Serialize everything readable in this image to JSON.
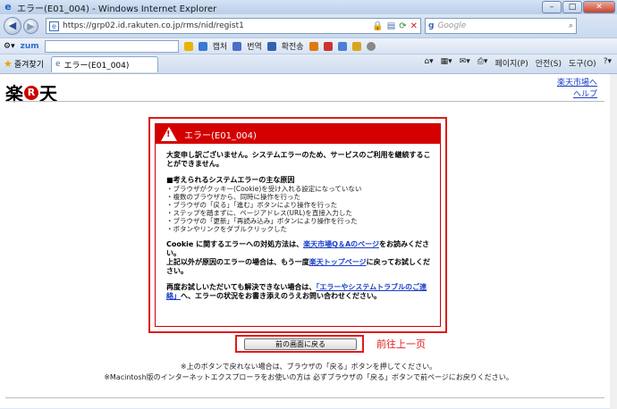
{
  "window": {
    "title": "エラー(E01_004) - Windows Internet Explorer",
    "minimize": "–",
    "maximize": "□",
    "close": "✕"
  },
  "address_bar": {
    "url": "https://grp02.id.rakuten.co.jp/rms/nid/regist1",
    "search_placeholder": "Google"
  },
  "toolbar": {
    "brand": "zum",
    "capture": "캡처",
    "translate": "번역",
    "dictionary": "확전송"
  },
  "favorites": {
    "label": "즐겨찾기",
    "tab_title": "エラー(E01_004)"
  },
  "command_bar": {
    "page": "페이지(P)",
    "safety": "안전(S)",
    "tools": "도구(O)"
  },
  "page": {
    "logo_left": "楽",
    "logo_r": "R",
    "logo_right": "天",
    "link_market": "楽天市場へ",
    "link_help": "ヘルプ",
    "error_title": "エラー(E01_004)",
    "lead": "大変申し訳ございません。システムエラーのため、サービスのご利用を継続することができません。",
    "causes_heading": "■考えられるシステムエラーの主な原因",
    "causes": [
      "・ブラウザがクッキー(Cookie)を受け入れる設定になっていない",
      "・複数のブラウザから、同時に操作を行った",
      "・ブラウザの「戻る」「進む」ボタンにより操作を行った",
      "・ステップを踏まずに、ページアドレス(URL)を直接入力した",
      "・ブラウザの「更新」「再読み込み」ボタンにより操作を行った",
      "・ボタンやリンクをダブルクリックした"
    ],
    "cookie_text_1": "Cookie に関するエラーへの対処方法は、",
    "cookie_link": "楽天市場Q＆Aのページ",
    "cookie_text_2": "をお読みください。",
    "other_text_1": "上記以外が原因のエラーの場合は、もう一度",
    "other_link": "楽天トップページ",
    "other_text_2": "に戻ってお試しください。",
    "retry_text_1": "再度お試しいただいても解決できない場合は、",
    "retry_link": "「エラーやシステムトラブルのご連絡」",
    "retry_text_2": "へ、エラーの状況をお書き添えのうえお問い合わせください。",
    "back_button": "前の画面に戻る",
    "annotation": "前往上一页",
    "note_1": "※上のボタンで戻れない場合は、ブラウザの「戻る」ボタンを押してください。",
    "note_2": "※Macintosh版のインターネットエクスプローラをお使いの方は 必ずブラウザの「戻る」ボタンで前ページにお戻りください。"
  },
  "colors": {
    "error_red": "#d40000",
    "link_blue": "#1a3ec9",
    "annotation_red": "#e01b1b"
  }
}
